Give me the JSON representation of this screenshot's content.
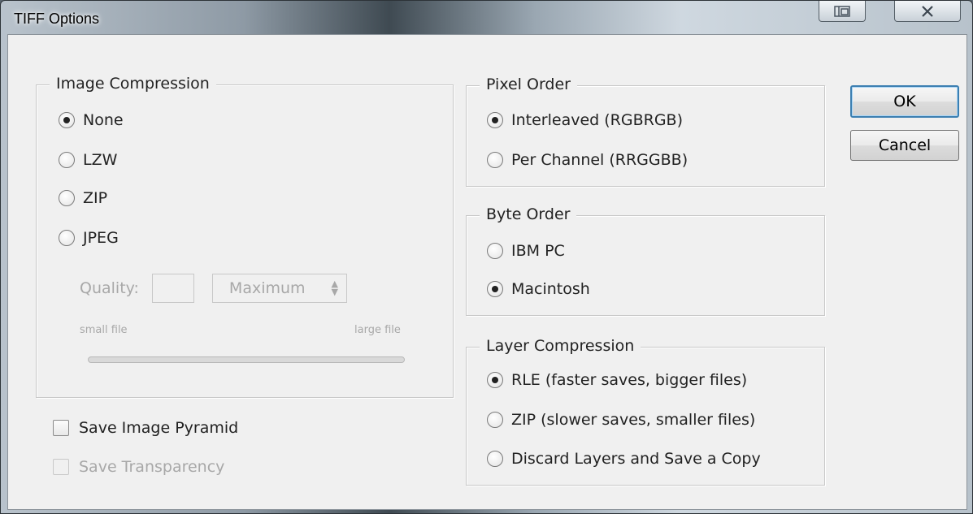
{
  "window": {
    "title": "TIFF Options"
  },
  "image_compression": {
    "legend": "Image Compression",
    "options": [
      "None",
      "LZW",
      "ZIP",
      "JPEG"
    ],
    "selected": "None",
    "quality_label": "Quality:",
    "quality_value": "",
    "quality_select": "Maximum",
    "small_file_label": "small file",
    "large_file_label": "large file"
  },
  "pixel_order": {
    "legend": "Pixel Order",
    "options": [
      "Interleaved (RGBRGB)",
      "Per Channel (RRGGBB)"
    ],
    "selected": "Interleaved (RGBRGB)"
  },
  "byte_order": {
    "legend": "Byte Order",
    "options": [
      "IBM PC",
      "Macintosh"
    ],
    "selected": "Macintosh"
  },
  "layer_compression": {
    "legend": "Layer Compression",
    "options": [
      "RLE (faster saves, bigger files)",
      "ZIP (slower saves, smaller files)",
      "Discard Layers and Save a Copy"
    ],
    "selected": "RLE (faster saves, bigger files)"
  },
  "checkboxes": {
    "save_image_pyramid": "Save Image Pyramid",
    "save_transparency": "Save Transparency"
  },
  "buttons": {
    "ok": "OK",
    "cancel": "Cancel"
  },
  "icons": {
    "restore": "restore-icon",
    "close": "close-icon"
  }
}
